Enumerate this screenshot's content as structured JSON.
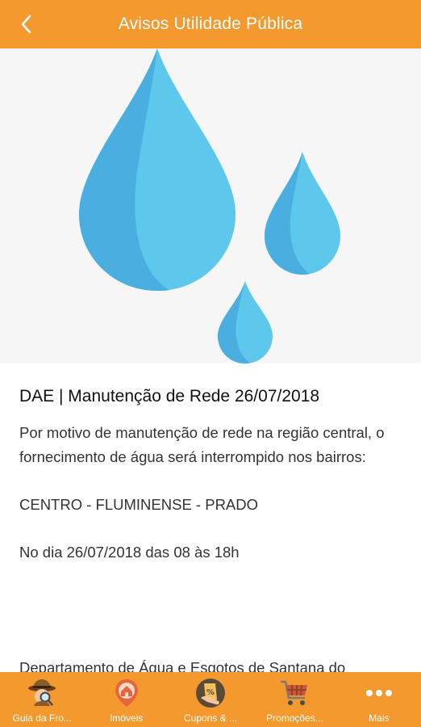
{
  "header": {
    "title": "Avisos Utilidade Pública",
    "accent_color": "#F4992E"
  },
  "hero": {
    "image": "water-drops-illustration",
    "colors": {
      "light": "#5EC8EC",
      "dark": "#4BAEE0"
    }
  },
  "notice": {
    "title": "DAE | Manutenção de Rede 26/07/2018",
    "body": "Por motivo de manutenção de rede na região central, o fornecimento de água será interrompido nos bairros:\n\nCENTRO - FLUMINENSE - PRADO\n\nNo dia 26/07/2018 das 08 às 18h",
    "footer_partial": "Departamento de Água e Esgotos de Santana do"
  },
  "tabbar": {
    "items": [
      {
        "label": "Guia da Fro...",
        "icon": "detective-icon"
      },
      {
        "label": "Imóveis",
        "icon": "house-pin-icon"
      },
      {
        "label": "Cupons & ...",
        "icon": "coupon-hand-icon"
      },
      {
        "label": "Promoções...",
        "icon": "shopping-cart-icon"
      },
      {
        "label": "Mais",
        "icon": "more-dots-icon"
      }
    ]
  }
}
